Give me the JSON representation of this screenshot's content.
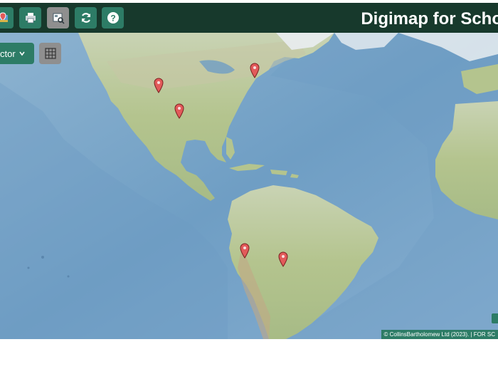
{
  "header": {
    "title": "Digimap for Scho",
    "buttons": [
      {
        "name": "map-pin-icon",
        "active": false
      },
      {
        "name": "print-icon",
        "active": false
      },
      {
        "name": "screenshot-icon",
        "active": true
      },
      {
        "name": "refresh-icon",
        "active": false
      },
      {
        "name": "help-icon",
        "active": false
      }
    ]
  },
  "map": {
    "selector_label": "ctor",
    "grid_icon": "grid-icon",
    "marker_count": 5,
    "attribution": "© CollinsBartholomew Ltd (2023).  |  FOR SC"
  },
  "colors": {
    "header_bg": "#17392c",
    "button_bg": "#2d7c66",
    "button_active_bg": "#8f8f8f",
    "ocean": "#7fa8c8",
    "land": "#b9c995",
    "marker": "#e25a5a"
  }
}
